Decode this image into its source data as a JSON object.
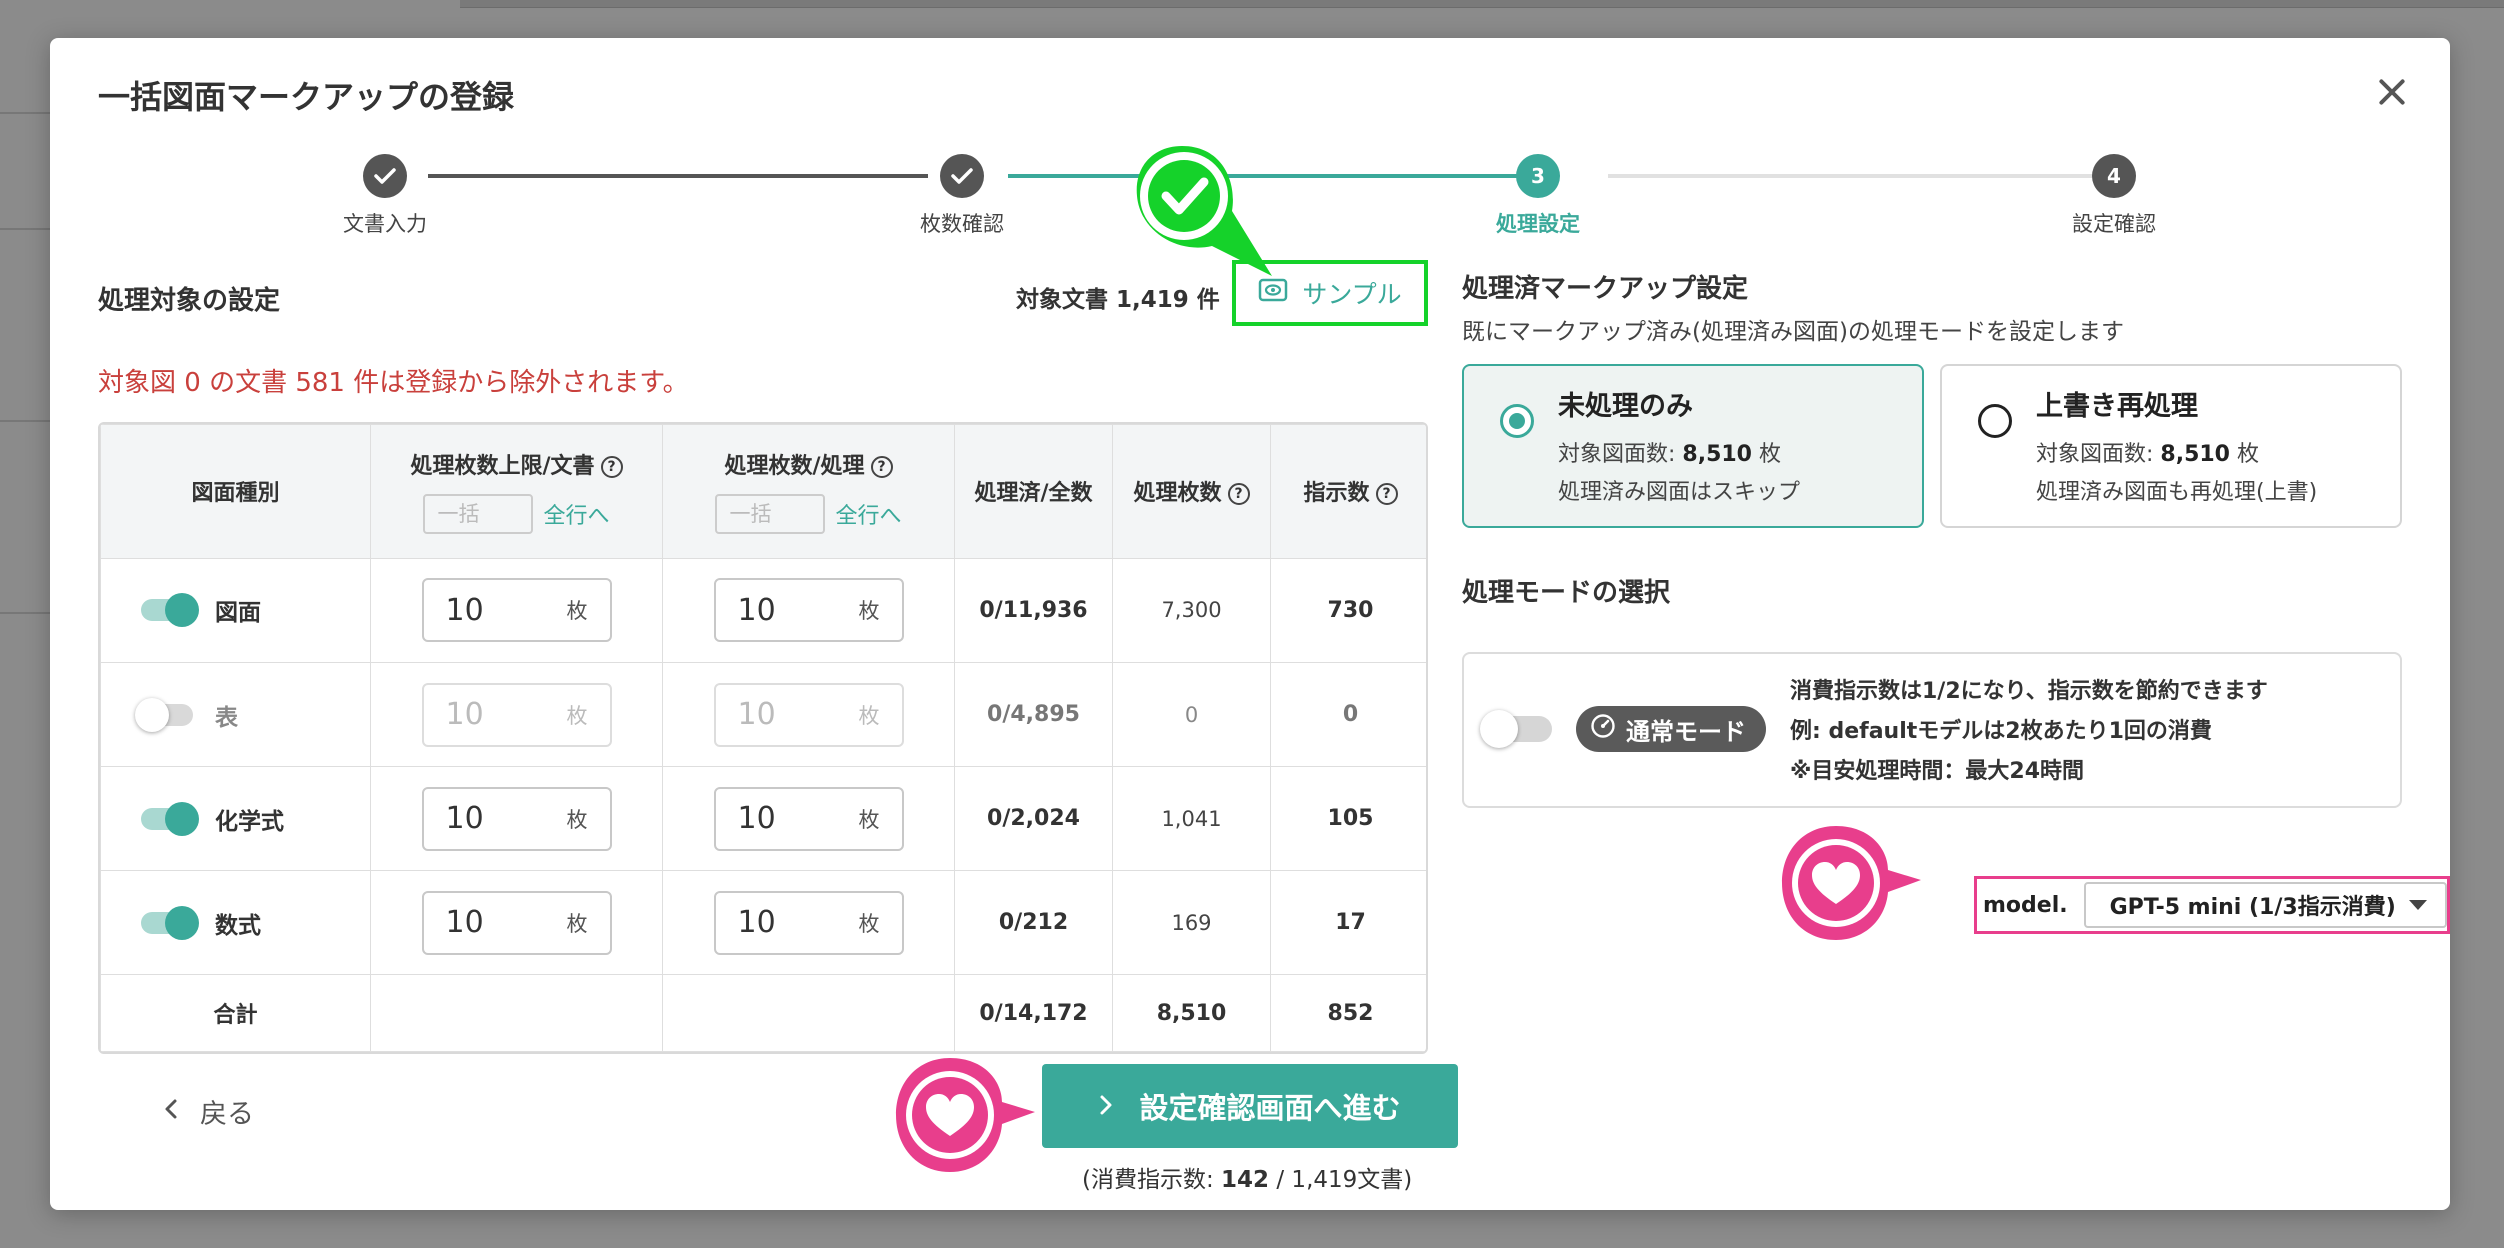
{
  "modal": {
    "title": "一括図面マークアップの登録"
  },
  "stepper": {
    "steps": [
      {
        "label": "文書入力",
        "state": "done"
      },
      {
        "label": "枚数確認",
        "state": "done"
      },
      {
        "label": "処理設定",
        "state": "active",
        "number": "3"
      },
      {
        "label": "設定確認",
        "state": "pending",
        "number": "4"
      }
    ]
  },
  "left": {
    "section_title": "処理対象の設定",
    "target_count": "対象文書 1,419 件",
    "sample_label": "サンプル",
    "warning": "対象図 0 の文書 581 件は登録から除外されます。"
  },
  "table": {
    "headers": {
      "kind": "図面種別",
      "limit": "処理枚数上限/文書",
      "per": "処理枚数/処理",
      "done_total": "処理済/全数",
      "count": "処理枚数",
      "instr": "指示数",
      "bulk_placeholder": "一括",
      "apply_all": "全行へ"
    },
    "rows": [
      {
        "kind": "図面",
        "enabled": true,
        "limit": "10",
        "per": "10",
        "unit": "枚",
        "done_total": "0/11,936",
        "count": "7,300",
        "instr": "730"
      },
      {
        "kind": "表",
        "enabled": false,
        "limit": "10",
        "per": "10",
        "unit": "枚",
        "done_total": "0/4,895",
        "count": "0",
        "instr": "0"
      },
      {
        "kind": "化学式",
        "enabled": true,
        "limit": "10",
        "per": "10",
        "unit": "枚",
        "done_total": "0/2,024",
        "count": "1,041",
        "instr": "105"
      },
      {
        "kind": "数式",
        "enabled": true,
        "limit": "10",
        "per": "10",
        "unit": "枚",
        "done_total": "0/212",
        "count": "169",
        "instr": "17"
      }
    ],
    "total": {
      "label": "合計",
      "done_total": "0/14,172",
      "count": "8,510",
      "instr": "852"
    }
  },
  "right": {
    "section_title": "処理済マークアップ設定",
    "description": "既にマークアップ済み(処理済み図面)の処理モードを設定します",
    "options": [
      {
        "title": "未処理のみ",
        "count_label": "対象図面数: ",
        "count": "8,510",
        "count_unit": " 枚",
        "note": "処理済み図面はスキップ",
        "selected": true
      },
      {
        "title": "上書き再処理",
        "count_label": "対象図面数: ",
        "count": "8,510",
        "count_unit": " 枚",
        "note": "処理済み図面も再処理(上書)",
        "selected": false
      }
    ],
    "mode_title": "処理モードの選択",
    "mode_badge": "通常モード",
    "mode_lines": [
      "消費指示数は1/2になり、指示数を節約できます",
      "例: defaultモデルは2枚あたり1回の消費",
      "※目安処理時間：最大24時間"
    ],
    "model_label": "model.",
    "model_value": "GPT-5 mini (1/3指示消費)"
  },
  "footer": {
    "back_label": "戻る",
    "next_label": "設定確認画面へ進む",
    "note_prefix": "(消費指示数: ",
    "note_value": "142",
    "note_suffix": " / 1,419文書)"
  },
  "colors": {
    "accent": "#3aa99a",
    "warning": "#c9403c",
    "highlight_green": "#15d22a",
    "highlight_pink": "#e83e8c"
  },
  "icons": [
    "check-icon",
    "close-icon",
    "eye-icon",
    "help-icon",
    "speedometer-icon",
    "chevron-left-icon",
    "chevron-right-icon",
    "caret-down-icon",
    "heart-icon"
  ]
}
